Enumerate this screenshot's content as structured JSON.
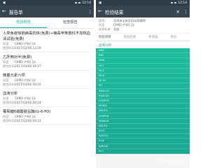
{
  "left": {
    "status_time": "12:14",
    "title": "报告单",
    "tabs": [
      "检验报告",
      "检查报告"
    ],
    "labels": {
      "dept": "科室",
      "time": "提交时间"
    },
    "items": [
      {
        "title": "人类免疫缺陷病毒抗体(免费)+梅毒甲苯胺红不加热血",
        "title2": "清试验(免费)",
        "dept": "CKM2-产科门诊",
        "time": "2017/03/06 13:29"
      },
      {
        "title": "乙肝两对半(免费)",
        "dept": "CKM2-产科门诊",
        "time": "2017/03/06 09:27"
      },
      {
        "title": "微量元素六项",
        "dept": "CKM2-产科门诊",
        "time": "2017/03/06 09:24"
      },
      {
        "title": "血液分析",
        "dept": "CKM2-产科门诊",
        "time": "2017/03/06 09:24"
      },
      {
        "title": "葡萄糖6磷酸脱氢酶(G-6-PD)",
        "dept": "CKM2-产科门诊",
        "time": "2017/03/06 09:23"
      }
    ]
  },
  "right": {
    "status_time": "12:14",
    "title": "检验结果",
    "info": [
      {
        "k": "医院",
        "v": "深圳市宝安区妇幼保健院"
      },
      {
        "k": "科室",
        "v": "CKM2-产科门诊"
      },
      {
        "k": "送检标本",
        "v": "全血"
      }
    ],
    "subtabs": [
      "检验项目",
      "检验结果",
      "参考值",
      "单位"
    ],
    "table_header": "血液分析",
    "rows": [
      [
        "WBC",
        "",
        "",
        ""
      ],
      [
        "RBC",
        "",
        "",
        ""
      ],
      [
        "HGB",
        "",
        "",
        ""
      ],
      [
        "HCT",
        "",
        "",
        ""
      ],
      [
        "MCV",
        "",
        "",
        ""
      ],
      [
        "MCH",
        "",
        "",
        ""
      ],
      [
        "MCHC",
        "",
        "",
        ""
      ],
      [
        "PLT",
        "",
        "",
        ""
      ],
      [
        "RDW-CV",
        "",
        "",
        ""
      ],
      [
        "RDW-SD",
        "",
        "",
        ""
      ],
      [
        "LYMPH%",
        "",
        "",
        ""
      ],
      [
        "MON%",
        "",
        "",
        ""
      ],
      [
        "NEUT%",
        "",
        "",
        ""
      ],
      [
        "LYMPH#",
        "",
        "",
        ""
      ],
      [
        "MONO#",
        "",
        "",
        ""
      ],
      [
        "NEUT#",
        "",
        "",
        ""
      ],
      [
        "EO%",
        "",
        "",
        ""
      ],
      [
        "BASO%",
        "",
        "",
        ""
      ],
      [
        "EO#",
        "",
        "",
        ""
      ],
      [
        "BASO#",
        "",
        "",
        ""
      ],
      [
        "PCT",
        "",
        "",
        ""
      ]
    ],
    "watermark": "宝安区妇幼"
  }
}
